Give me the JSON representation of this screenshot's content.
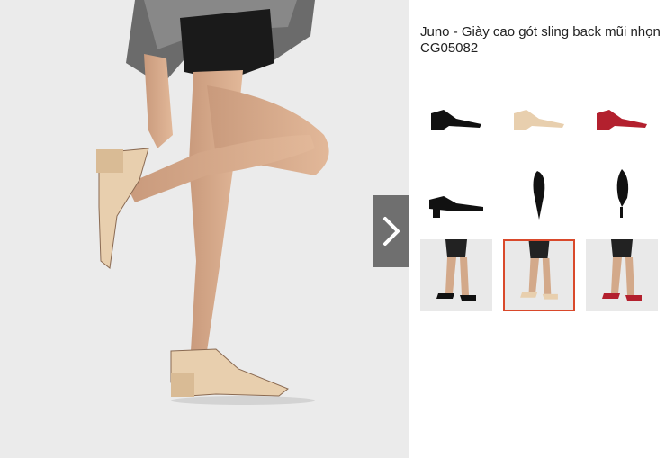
{
  "product": {
    "title": "Juno - Giày cao gót sling back mũi nhọn CG05082"
  },
  "gallery": {
    "next_icon": "chevron-right-icon",
    "thumbnails": [
      {
        "label": "black-side-view",
        "color": "#111111"
      },
      {
        "label": "nude-side-view",
        "color": "#e8cfae"
      },
      {
        "label": "red-side-view",
        "color": "#b3202e"
      },
      {
        "label": "black-profile-view",
        "color": "#111111"
      },
      {
        "label": "black-top-view",
        "color": "#111111"
      },
      {
        "label": "black-sole-view",
        "color": "#111111"
      },
      {
        "label": "model-black-shoes",
        "color": "#111111"
      },
      {
        "label": "model-nude-shoes",
        "color": "#e8cfae"
      },
      {
        "label": "model-red-shoes",
        "color": "#b3202e"
      }
    ],
    "selected_index": 7
  },
  "colors": {
    "selection_border": "#d9492b",
    "nav_button_bg": "#6f6f6f"
  }
}
